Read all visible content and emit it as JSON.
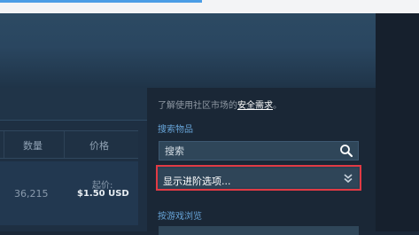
{
  "table": {
    "headers": {
      "quantity": "数量",
      "price": "价格"
    },
    "row": {
      "quantity": "36,215",
      "price_prefix": "起价:",
      "price_value": "$1.50 USD"
    }
  },
  "sidebar": {
    "notice_prefix": "了解使用社区市场的",
    "notice_link": "安全需求",
    "notice_suffix": "。",
    "search_section_label": "搜索物品",
    "search": {
      "placeholder": "搜索"
    },
    "advanced_options_label": "显示进阶选项...",
    "browse_by_game_label": "按游戏浏览"
  },
  "icons": {
    "search": "magnifier-icon",
    "advanced": "double-chevron-down-icon"
  },
  "colors": {
    "highlight_border": "#e13a44",
    "link_blue": "#67a4d8",
    "page_bg": "#1b2838"
  }
}
